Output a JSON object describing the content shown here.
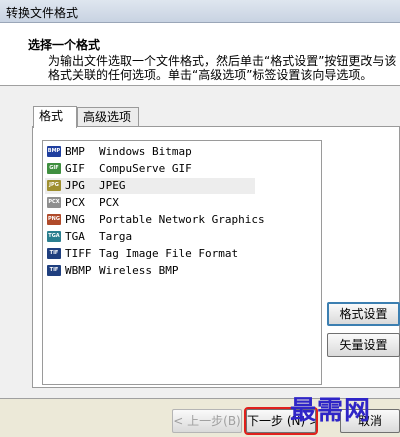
{
  "window": {
    "title": "转换文件格式"
  },
  "header": {
    "title": "选择一个格式",
    "description": "为输出文件选取一个文件格式，然后单击“格式设置”按钮更改与该格式关联的任何选项。单击“高级选项”标签设置该向导选项。"
  },
  "tabs": [
    {
      "label": "格式",
      "active": true
    },
    {
      "label": "高级选项",
      "active": false
    }
  ],
  "formats": [
    {
      "ext": "BMP",
      "name": "Windows Bitmap",
      "icon": "BMP",
      "color": "#1f3f9f"
    },
    {
      "ext": "GIF",
      "name": "CompuServe GIF",
      "icon": "GIF",
      "color": "#3f8f3f"
    },
    {
      "ext": "JPG",
      "name": "JPEG",
      "icon": "JPG",
      "color": "#9f8f2f",
      "selected": true
    },
    {
      "ext": "PCX",
      "name": "PCX",
      "icon": "PCX",
      "color": "#8f8f8f"
    },
    {
      "ext": "PNG",
      "name": "Portable Network Graphics",
      "icon": "PNG",
      "color": "#b04a2a"
    },
    {
      "ext": "TGA",
      "name": "Targa",
      "icon": "TGA",
      "color": "#2a7f8f"
    },
    {
      "ext": "TIFF",
      "name": "Tag Image File Format",
      "icon": "TIF",
      "color": "#1f3f7f"
    },
    {
      "ext": "WBMP",
      "name": "Wireless BMP",
      "icon": "TIF",
      "color": "#1f3f7f"
    }
  ],
  "buttons": {
    "format_settings": "格式设置",
    "vector_settings": "矢量设置",
    "back": "< 上一步(B)",
    "next": "下一步 (N) >",
    "cancel": "取消"
  },
  "watermark": "最需网"
}
